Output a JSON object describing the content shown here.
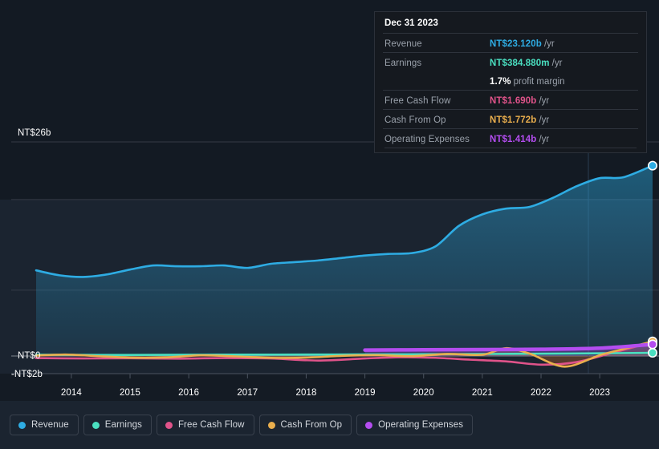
{
  "chart_data": {
    "type": "area",
    "title": "",
    "xlabel": "",
    "ylabel": "",
    "currency": "NT$",
    "grid": true,
    "legend_position": "bottom",
    "x_tick_labels": [
      "2014",
      "2015",
      "2016",
      "2017",
      "2018",
      "2019",
      "2020",
      "2021",
      "2022",
      "2023"
    ],
    "y_tick_labels": [
      "NT$26b",
      "NT$0",
      "-NT$2b"
    ],
    "ylim": [
      -2,
      26
    ],
    "y_gridline_values": [
      26,
      19,
      8,
      0,
      -2
    ],
    "series": [
      {
        "name": "Revenue",
        "color": "#2eace3",
        "unit": "b",
        "x": [
          2013.4,
          2013.8,
          2014.2,
          2014.6,
          2015.0,
          2015.4,
          2015.8,
          2016.2,
          2016.6,
          2017.0,
          2017.4,
          2017.8,
          2018.2,
          2018.6,
          2019.0,
          2019.4,
          2019.8,
          2020.2,
          2020.6,
          2021.0,
          2021.4,
          2021.8,
          2022.2,
          2022.6,
          2023.0,
          2023.4,
          2023.9
        ],
        "values": [
          10.4,
          9.8,
          9.6,
          9.9,
          10.5,
          11.0,
          10.9,
          10.9,
          11.0,
          10.7,
          11.2,
          11.4,
          11.6,
          11.9,
          12.2,
          12.4,
          12.5,
          13.3,
          15.8,
          17.2,
          17.9,
          18.1,
          19.2,
          20.6,
          21.6,
          21.7,
          23.12
        ]
      },
      {
        "name": "Earnings",
        "color": "#4adfc0",
        "unit": "m",
        "x": [
          2013.4,
          2014.5,
          2015.5,
          2016.5,
          2017.5,
          2018.5,
          2019.5,
          2020.5,
          2021.5,
          2022.5,
          2023.9
        ],
        "values": [
          150,
          130,
          140,
          160,
          170,
          180,
          200,
          230,
          260,
          300,
          384.88
        ]
      },
      {
        "name": "Free Cash Flow",
        "color": "#e0538a",
        "unit": "b",
        "x": [
          2013.4,
          2014.2,
          2015.0,
          2015.8,
          2016.6,
          2017.4,
          2018.2,
          2019.0,
          2019.6,
          2020.2,
          2020.8,
          2021.4,
          2022.0,
          2022.6,
          2023.2,
          2023.9
        ],
        "values": [
          -0.25,
          -0.3,
          -0.28,
          -0.32,
          -0.25,
          -0.3,
          -0.55,
          -0.3,
          -0.15,
          -0.22,
          -0.45,
          -0.65,
          -1.05,
          -0.75,
          0.35,
          1.69
        ]
      },
      {
        "name": "Cash From Op",
        "color": "#e9ae4d",
        "unit": "b",
        "x": [
          2013.4,
          2013.9,
          2014.4,
          2015.0,
          2015.6,
          2016.2,
          2016.8,
          2017.4,
          2018.0,
          2018.6,
          2019.2,
          2019.8,
          2020.4,
          2021.0,
          2021.4,
          2021.8,
          2022.4,
          2023.0,
          2023.4,
          2023.9
        ],
        "values": [
          0.05,
          0.18,
          0.0,
          -0.2,
          -0.18,
          0.08,
          -0.05,
          -0.22,
          -0.2,
          0.02,
          0.1,
          -0.02,
          0.25,
          0.15,
          0.95,
          0.3,
          -1.3,
          0.1,
          0.85,
          1.772
        ]
      },
      {
        "name": "Operating Expenses",
        "color": "#b44df0",
        "unit": "b",
        "x": [
          2019.0,
          2020.0,
          2021.0,
          2022.0,
          2023.0,
          2023.9
        ],
        "values": [
          0.72,
          0.75,
          0.78,
          0.82,
          0.95,
          1.414
        ]
      }
    ]
  },
  "tooltip": {
    "date": "Dec 31 2023",
    "rows": [
      {
        "label": "Revenue",
        "value": "NT$23.120b",
        "suffix": "/yr",
        "color": "#2eace3"
      },
      {
        "label": "Earnings",
        "value": "NT$384.880m",
        "suffix": "/yr",
        "color": "#4adfc0"
      },
      {
        "label": "",
        "value": "1.7%",
        "suffix": "profit margin",
        "color": "#ffffff"
      },
      {
        "label": "Free Cash Flow",
        "value": "NT$1.690b",
        "suffix": "/yr",
        "color": "#e0538a"
      },
      {
        "label": "Cash From Op",
        "value": "NT$1.772b",
        "suffix": "/yr",
        "color": "#e9ae4d"
      },
      {
        "label": "Operating Expenses",
        "value": "NT$1.414b",
        "suffix": "/yr",
        "color": "#b44df0"
      }
    ]
  },
  "legend": {
    "items": [
      {
        "label": "Revenue",
        "color": "#2eace3"
      },
      {
        "label": "Earnings",
        "color": "#4adfc0"
      },
      {
        "label": "Free Cash Flow",
        "color": "#e0538a"
      },
      {
        "label": "Cash From Op",
        "color": "#e9ae4d"
      },
      {
        "label": "Operating Expenses",
        "color": "#b44df0"
      }
    ]
  },
  "axis": {
    "y_top_label": "NT$26b",
    "y_zero_label": "NT$0",
    "y_bottom_label": "-NT$2b",
    "x_labels": [
      "2014",
      "2015",
      "2016",
      "2017",
      "2018",
      "2019",
      "2020",
      "2021",
      "2022",
      "2023"
    ]
  }
}
